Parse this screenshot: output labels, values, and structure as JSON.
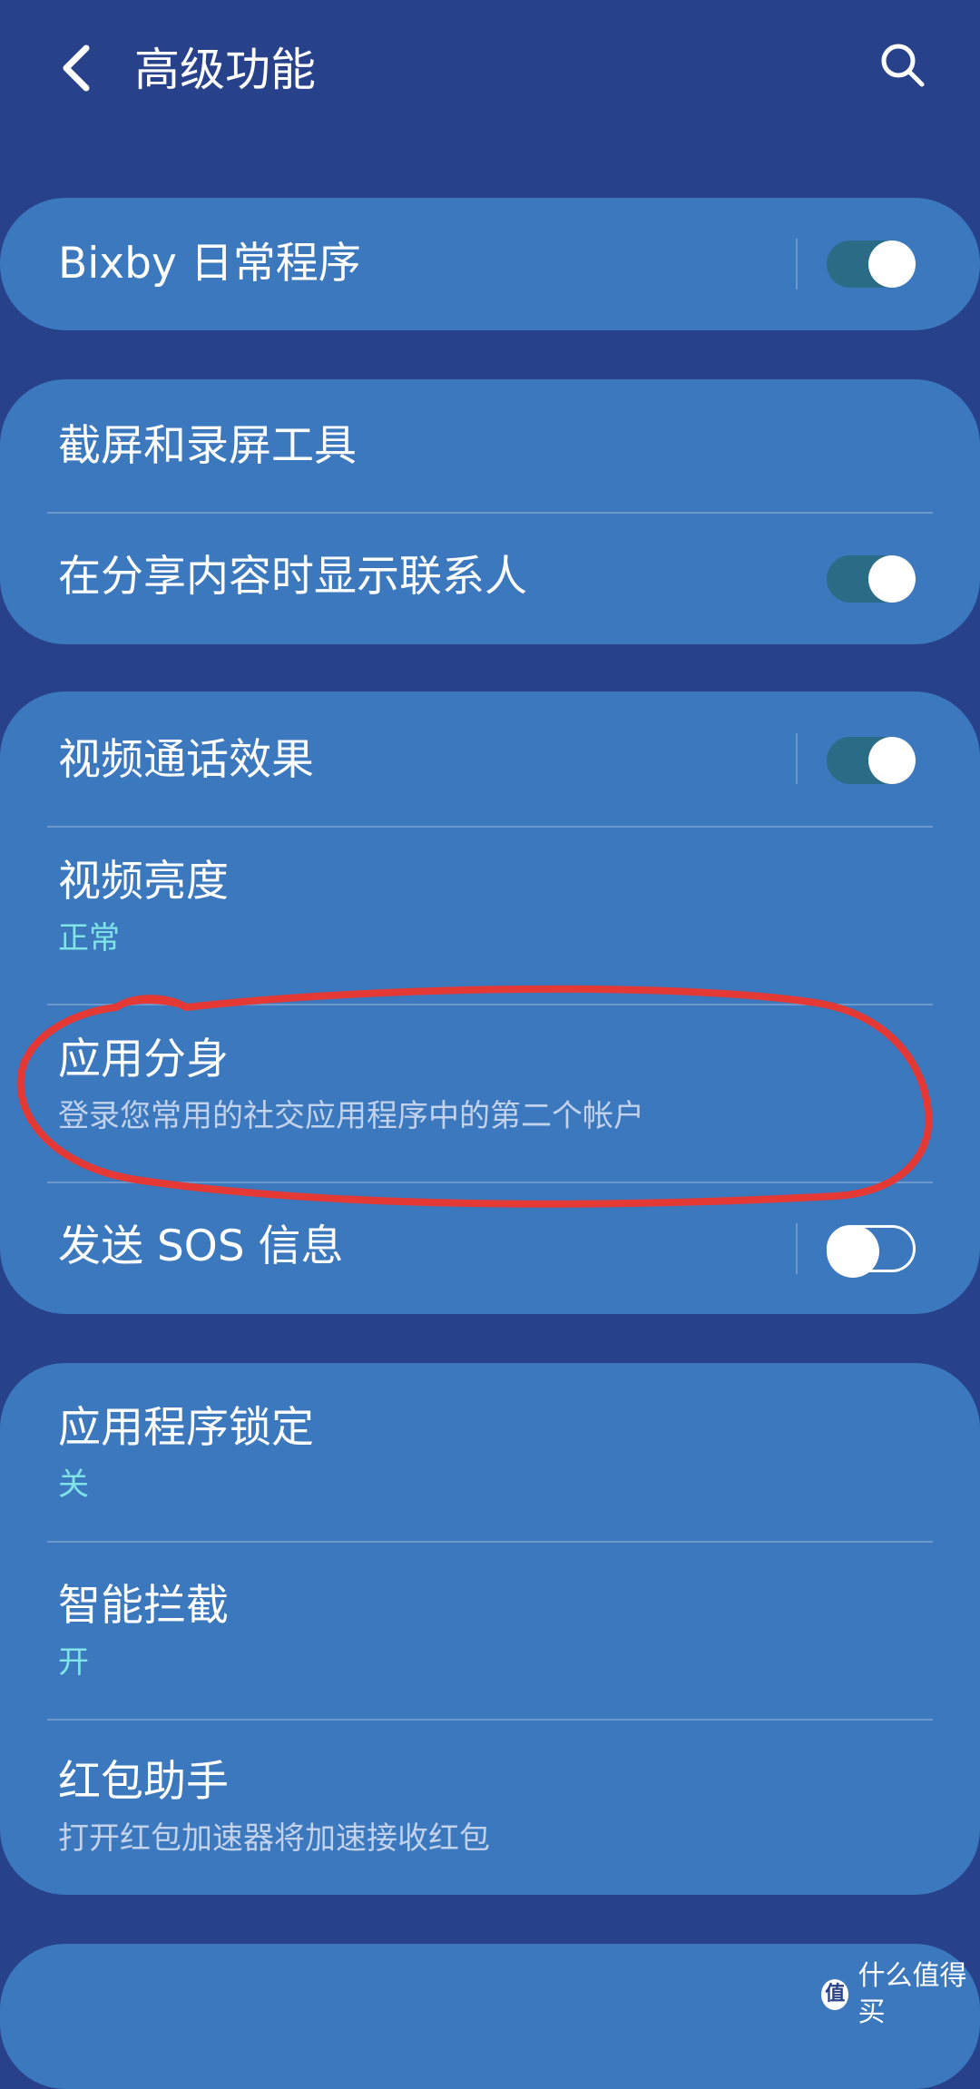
{
  "header": {
    "title": "高级功能",
    "back_icon": "chevron-left-icon",
    "search_icon": "search-icon"
  },
  "cards": [
    {
      "rows": [
        {
          "label": "Bixby 日常程序",
          "toggle": "on"
        }
      ]
    },
    {
      "rows": [
        {
          "label": "截屏和录屏工具"
        },
        {
          "label": "在分享内容时显示联系人",
          "toggle": "on"
        }
      ]
    },
    {
      "rows": [
        {
          "label": "视频通话效果",
          "toggle": "on"
        },
        {
          "label": "视频亮度",
          "sub": "正常"
        },
        {
          "label": "应用分身",
          "sub": "登录您常用的社交应用程序中的第二个帐户"
        },
        {
          "label": "发送 SOS 信息",
          "toggle": "off"
        }
      ]
    },
    {
      "rows": [
        {
          "label": "应用程序锁定",
          "sub": "关"
        },
        {
          "label": "智能拦截",
          "sub": "开"
        },
        {
          "label": "红包助手",
          "sub": "打开红包加速器将加速接收红包"
        }
      ]
    }
  ],
  "watermark": {
    "logo": "值",
    "text": "什么值得买"
  },
  "colors": {
    "background": "#27418b",
    "card": "#3b78bd",
    "accent": "#7fe3e8",
    "toggle_track_on": "#2a6b85",
    "annotation": "#e53935"
  }
}
